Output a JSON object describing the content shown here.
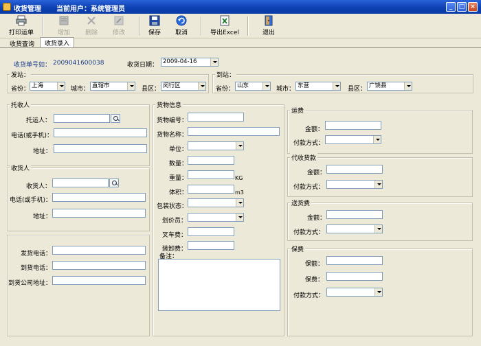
{
  "window": {
    "title": "收货管理",
    "user_label": "当前用户：系统管理员"
  },
  "toolbar": {
    "print": "打印运单",
    "add": "增加",
    "delete": "删除",
    "edit": "修改",
    "save": "保存",
    "cancel": "取消",
    "export": "导出Excel",
    "exit": "退出"
  },
  "tabs": {
    "query": "收货查询",
    "entry": "收货录入"
  },
  "header": {
    "order_no_label": "收货单号如：",
    "order_no_value": "2009041600038",
    "date_label": "收货日期：",
    "date_value": "2009-04-16"
  },
  "origin": {
    "title": "发站：",
    "province_label": "省份：",
    "province": "上海",
    "city_label": "城市：",
    "city": "直辖市",
    "district_label": "县区：",
    "district": "闵行区"
  },
  "dest": {
    "title": "到站：",
    "province_label": "省份：",
    "province": "山东",
    "city_label": "城市：",
    "city": "东营",
    "district_label": "县区：",
    "district": "广饶县"
  },
  "shipper": {
    "title": "托收人",
    "name_label": "托运人：",
    "phone_label": "电话(或手机)：",
    "address_label": "地址："
  },
  "consignee": {
    "title": "收货人",
    "name_label": "收货人：",
    "phone_label": "电话(或手机)：",
    "address_label": "地址："
  },
  "contact": {
    "send_phone_label": "发货电话：",
    "arrive_phone_label": "到货电话：",
    "company_address_label": "到货公司地址："
  },
  "goods": {
    "title": "货物信息",
    "code_label": "货物编号：",
    "name_label": "货物名称：",
    "unit_label": "单位：",
    "qty_label": "数量：",
    "weight_label": "重量：",
    "weight_unit": "KG",
    "volume_label": "体积：",
    "volume_unit": "m3",
    "packing_label": "包装状态：",
    "pricer_label": "划价员：",
    "forklift_label": "叉车费：",
    "loading_label": "装卸费：",
    "remark_label": "备注："
  },
  "freight": {
    "title": "运费",
    "amount_label": "金额：",
    "pay_label": "付款方式："
  },
  "cod": {
    "title": "代收货款",
    "amount_label": "金额：",
    "pay_label": "付款方式："
  },
  "delivery": {
    "title": "送货费",
    "amount_label": "金额：",
    "pay_label": "付款方式："
  },
  "insurance": {
    "title": "保费",
    "insured_label": "保额：",
    "premium_label": "保费：",
    "pay_label": "付款方式："
  }
}
